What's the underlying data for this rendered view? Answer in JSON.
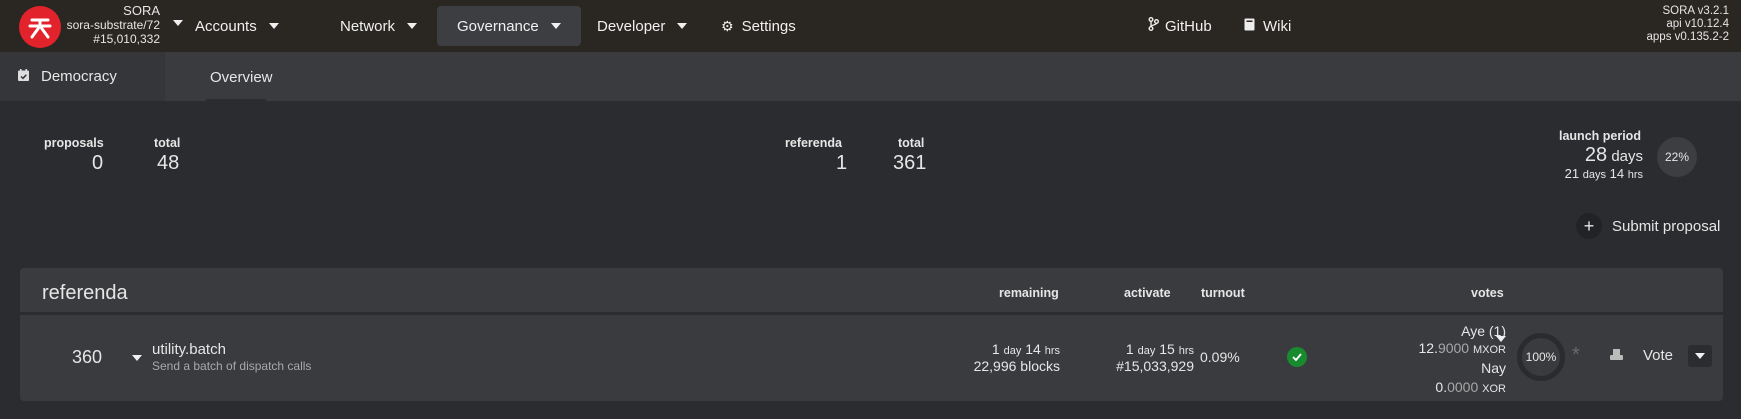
{
  "header": {
    "chain": {
      "name": "SORA",
      "runtime": "sora-substrate/72",
      "block": "#15,010,332"
    },
    "menu": [
      {
        "label": "Accounts"
      },
      {
        "label": "Network"
      },
      {
        "label": "Governance"
      },
      {
        "label": "Developer"
      },
      {
        "label": "Settings"
      }
    ],
    "links": {
      "github": "GitHub",
      "wiki": "Wiki"
    },
    "version": {
      "sora": "SORA v3.2.1",
      "api": "api v10.12.4",
      "apps": "apps v0.135.2-2"
    }
  },
  "subnav": {
    "section": "Democracy",
    "tab": "Overview"
  },
  "summary": {
    "proposals_label": "proposals",
    "proposals_value": "0",
    "proposals_total_label": "total",
    "proposals_total_value": "48",
    "referenda_label": "referenda",
    "referenda_value": "1",
    "referenda_total_label": "total",
    "referenda_total_value": "361",
    "launch_label": "launch period",
    "launch_main_num": "28",
    "launch_main_unit": "days",
    "launch_sub_days": "21",
    "launch_sub_days_unit": "days",
    "launch_sub_hrs": "14",
    "launch_sub_hrs_unit": "hrs",
    "launch_percent": "22%"
  },
  "actions": {
    "submit": "Submit proposal"
  },
  "table": {
    "title": "referenda",
    "columns": {
      "remaining": "remaining",
      "activate": "activate",
      "turnout": "turnout",
      "votes": "votes"
    },
    "rows": [
      {
        "id": "360",
        "call": "utility.batch",
        "description": "Send a batch of dispatch calls",
        "remaining_d": "1",
        "remaining_d_unit": "day",
        "remaining_h": "14",
        "remaining_h_unit": "hrs",
        "remaining_blocks": "22,996 blocks",
        "activate_d": "1",
        "activate_d_unit": "day",
        "activate_h": "15",
        "activate_h_unit": "hrs",
        "activate_block": "#15,033,929",
        "turnout": "0.09%",
        "aye_label": "Aye (1)",
        "aye_int": "12.",
        "aye_dec": "9000",
        "aye_unit": "MXOR",
        "nay_label": "Nay",
        "nay_int": "0.",
        "nay_dec": "0000",
        "nay_unit": "XOR",
        "vote_percent": "100%",
        "vote_button": "Vote"
      }
    ]
  },
  "colors": {
    "accent": "#e3232c",
    "topbar": "#2a2622",
    "approved": "#1a8a2f"
  }
}
